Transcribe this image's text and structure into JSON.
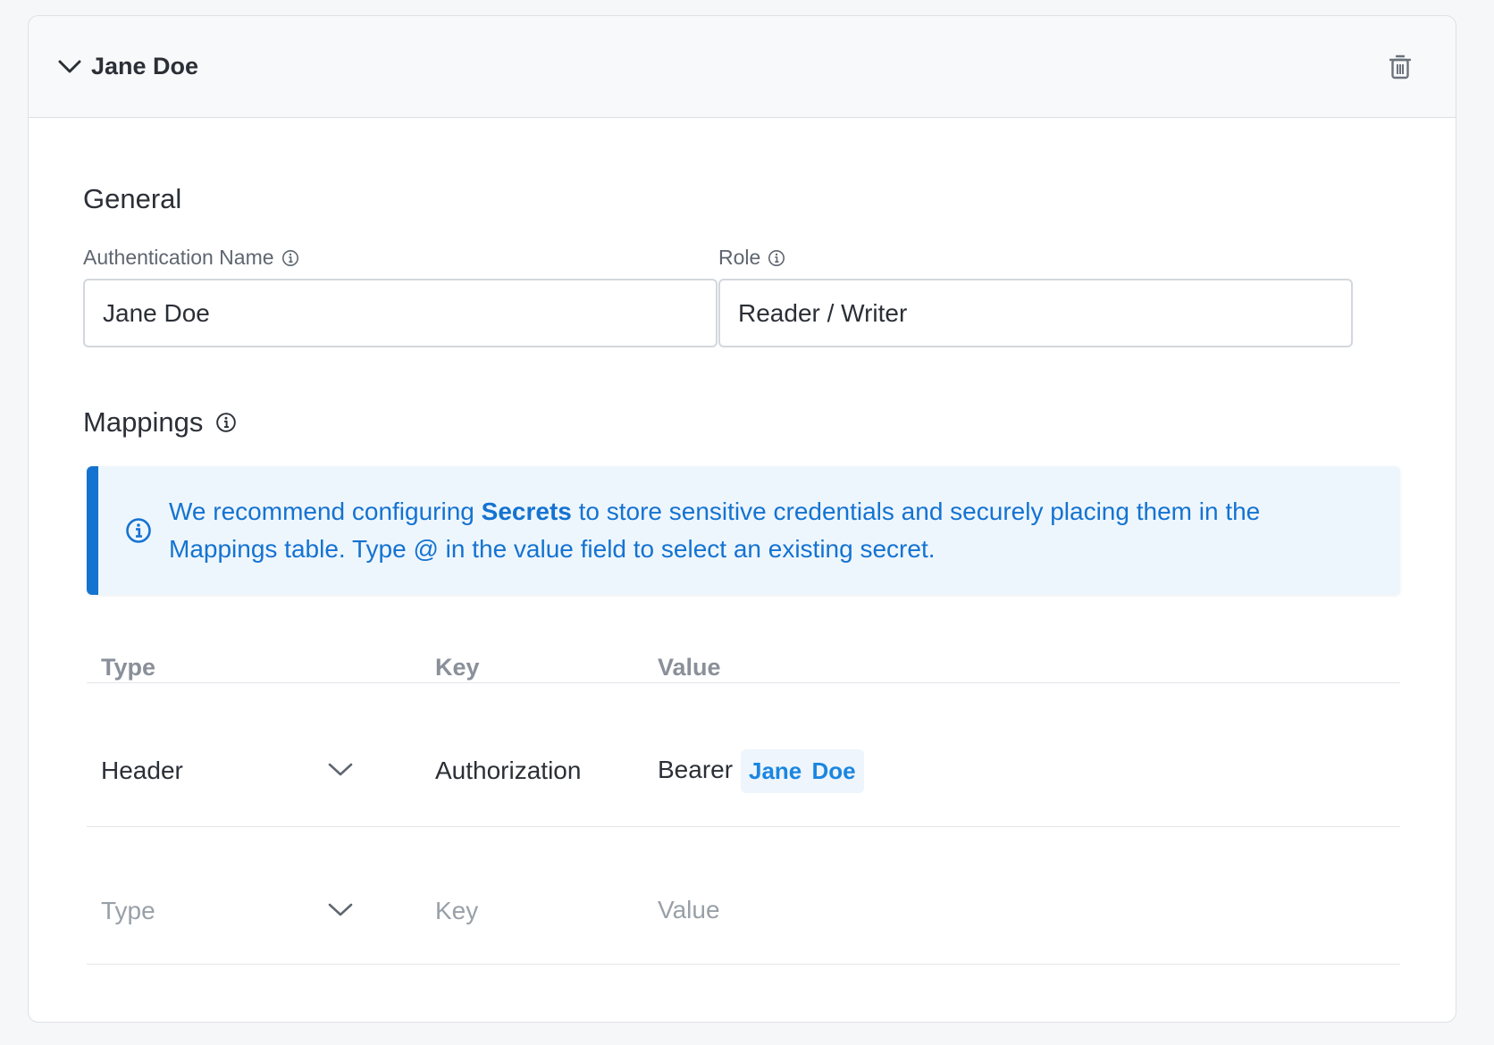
{
  "header": {
    "title": "Jane Doe"
  },
  "general": {
    "section_title": "General",
    "auth_name_label": "Authentication Name",
    "auth_name_value": "Jane Doe",
    "role_label": "Role",
    "role_value": "Reader / Writer"
  },
  "mappings": {
    "section_title": "Mappings",
    "banner": {
      "text_before": "We recommend configuring ",
      "link_text": "Secrets",
      "text_after": " to store sensitive credentials and securely placing them in the Mappings table. Type @ in the value field to select an existing secret."
    },
    "columns": [
      "Type",
      "Key",
      "Value"
    ],
    "rows": [
      {
        "type": "Header",
        "key": "Authorization",
        "value_prefix": "Bearer",
        "secret": "Jane Doe"
      }
    ],
    "new_row": {
      "type_placeholder": "Type",
      "key_placeholder": "Key",
      "value_placeholder": "Value"
    }
  },
  "colors": {
    "accent": "#1473d1",
    "secret_chip_text": "#1b86e0",
    "banner_bg": "#eef6fd"
  },
  "icons": [
    "chevron-down-icon",
    "trash-icon",
    "info-icon"
  ]
}
